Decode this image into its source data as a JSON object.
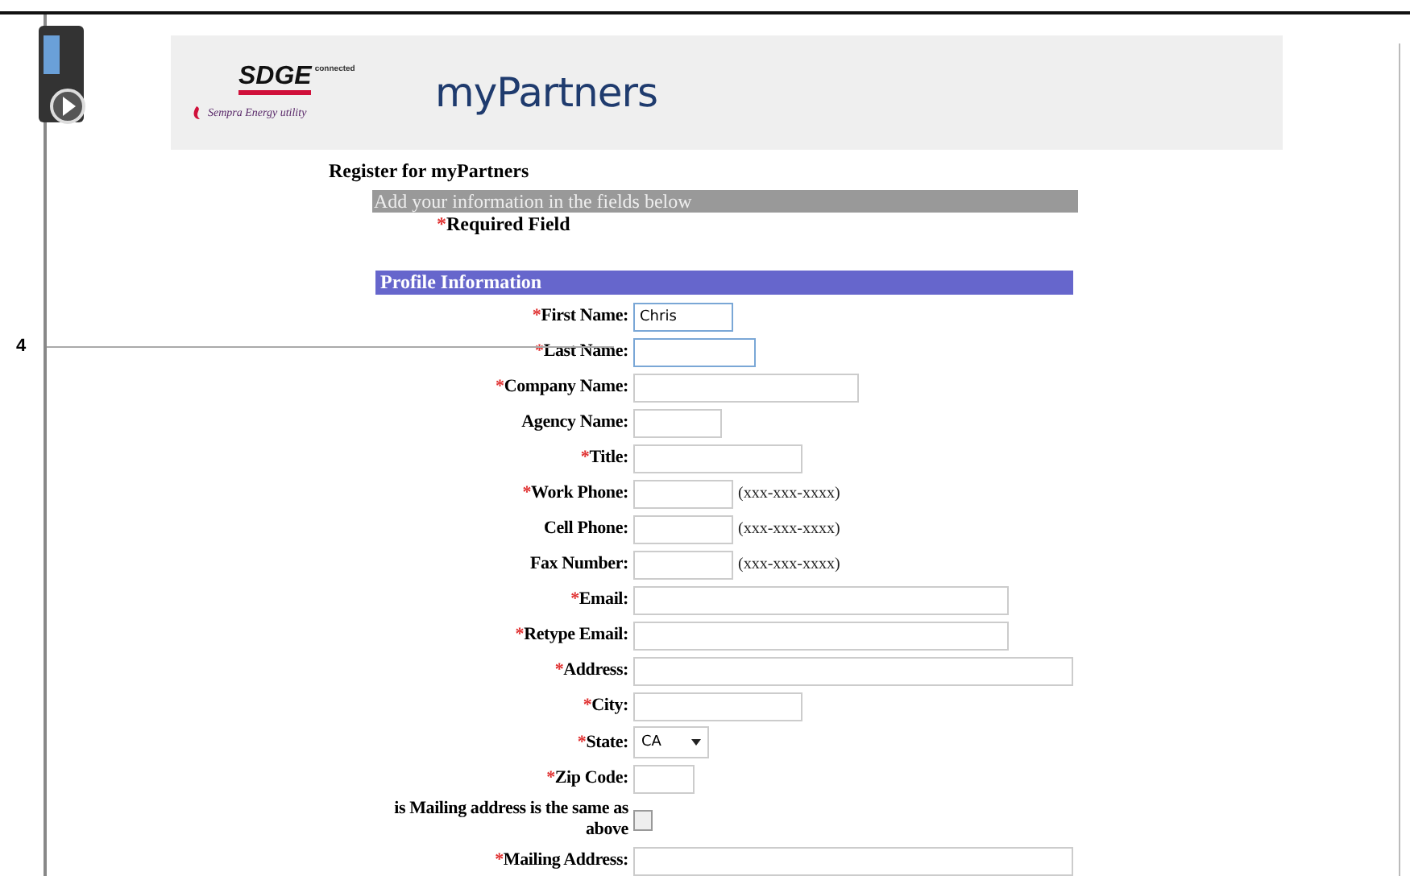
{
  "callout": {
    "number": "4"
  },
  "header": {
    "logo_text": "SDGE",
    "logo_tag": "connected",
    "logo_sub": "Sempra Energy utility",
    "app_title": "myPartners"
  },
  "page_title": "Register for myPartners",
  "instructions": "Add your information in the fields below",
  "required_note": {
    "mark": "*",
    "text": "Required Field"
  },
  "section": "Profile Information",
  "fields": [
    {
      "kind": "text",
      "label": "First Name:",
      "required": true,
      "value": "Chris",
      "focused": true
    },
    {
      "kind": "text",
      "label": "Last Name:",
      "required": true,
      "focused": true
    },
    {
      "kind": "text",
      "label": "Company Name:",
      "required": true,
      "focused": false
    },
    {
      "kind": "text",
      "label": "Agency Name:",
      "required": false,
      "focused": false
    },
    {
      "kind": "text",
      "label": "Title:",
      "required": true,
      "focused": false
    },
    {
      "kind": "text",
      "label": "Work Phone:",
      "required": true,
      "hint": "(xxx-xxx-xxxx)",
      "focused": false
    },
    {
      "kind": "text",
      "label": "Cell Phone:",
      "required": false,
      "hint": "(xxx-xxx-xxxx)",
      "focused": false
    },
    {
      "kind": "text",
      "label": "Fax Number:",
      "required": false,
      "hint": "(xxx-xxx-xxxx)",
      "focused": false
    },
    {
      "kind": "text",
      "label": "Email:",
      "required": true,
      "focused": false
    },
    {
      "kind": "text",
      "label": "Retype Email:",
      "required": true,
      "focused": false
    },
    {
      "kind": "text",
      "label": "Address:",
      "required": true,
      "focused": false
    },
    {
      "kind": "text",
      "label": "City:",
      "required": true,
      "focused": false
    },
    {
      "kind": "select",
      "label": "State:",
      "required": true,
      "value": "CA"
    },
    {
      "kind": "text",
      "label": "Zip Code:",
      "required": true,
      "focused": false
    },
    {
      "kind": "checkbox",
      "label": "is Mailing address is the same as above",
      "required": false,
      "checked": false
    },
    {
      "kind": "text",
      "label": "Mailing Address:",
      "required": true,
      "focused": false
    }
  ]
}
